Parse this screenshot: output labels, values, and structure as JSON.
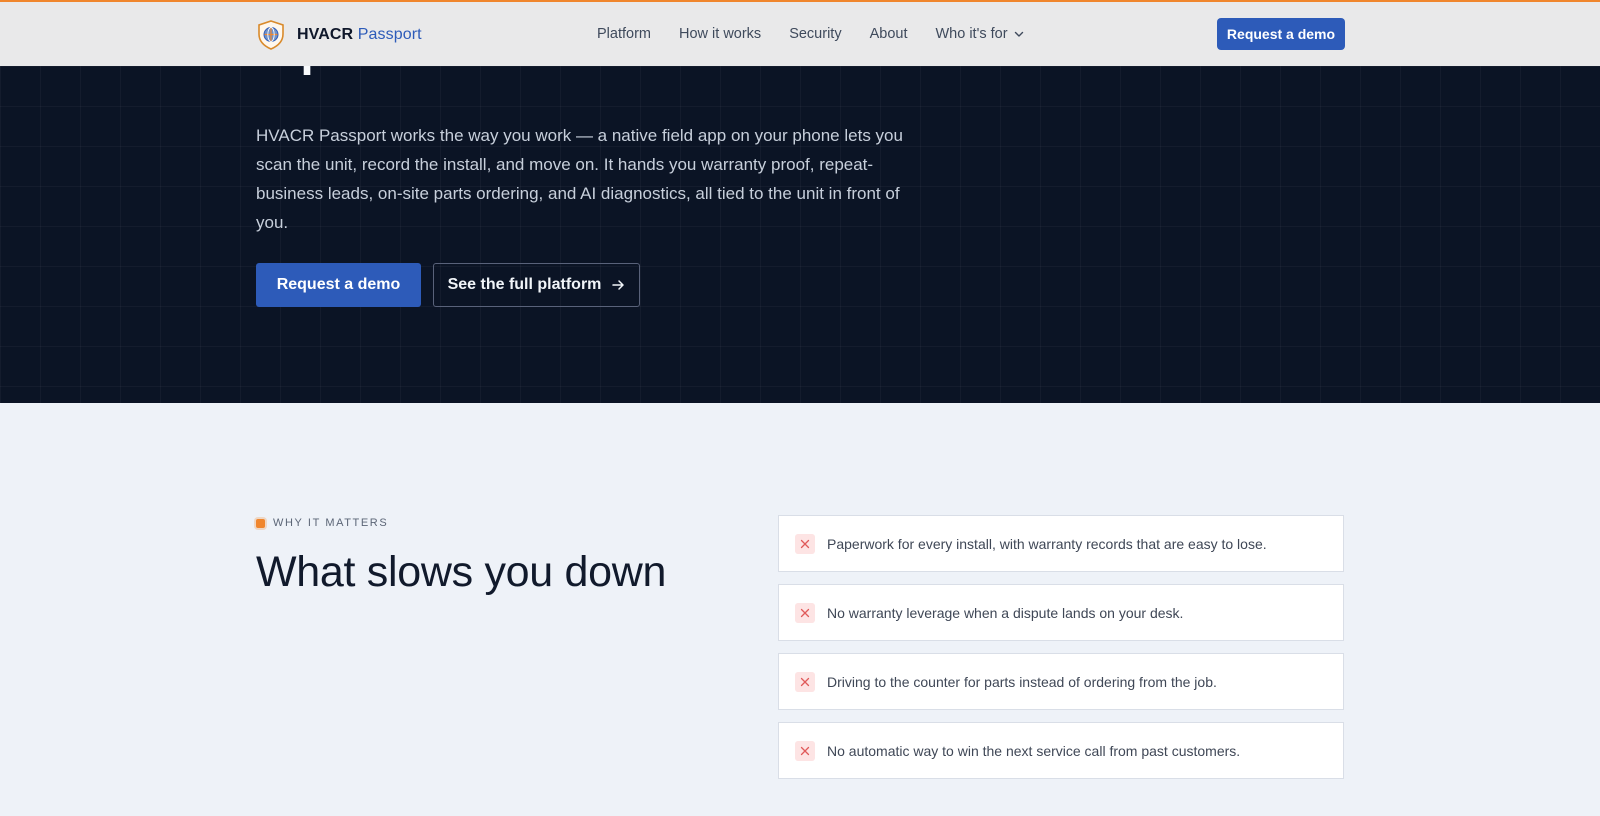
{
  "brand": {
    "name": "HVACR",
    "accent": "Passport"
  },
  "nav": {
    "items": [
      "Platform",
      "How it works",
      "Security",
      "About"
    ],
    "dropdown_label": "Who it's for"
  },
  "header": {
    "cta_label": "Request a demo"
  },
  "hero": {
    "title": "repeat business.",
    "description": "HVACR Passport works the way you work — a native field app on your phone lets you scan the unit, record the install, and move on. It hands you warranty proof, repeat-business leads, on-site parts ordering, and AI diagnostics, all tied to the unit in front of you.",
    "primary_cta": "Request a demo",
    "secondary_cta": "See the full platform"
  },
  "why": {
    "eyebrow": "WHY IT MATTERS",
    "title": "What slows you down",
    "pains": [
      "Paperwork for every install, with warranty records that are easy to lose.",
      "No warranty leverage when a dispute lands on your desk.",
      "Driving to the counter for parts instead of ordering from the job.",
      "No automatic way to win the next service call from past customers."
    ]
  },
  "colors": {
    "accent_orange": "#f0862d",
    "brand_blue": "#2d5bb9",
    "hero_bg": "#0b1425",
    "section_bg": "#eef2f8"
  },
  "icons": {
    "logo": "shield-globe-logo",
    "dropdown": "chevron-down-icon",
    "arrow": "arrow-right-icon",
    "pain": "x-icon"
  }
}
